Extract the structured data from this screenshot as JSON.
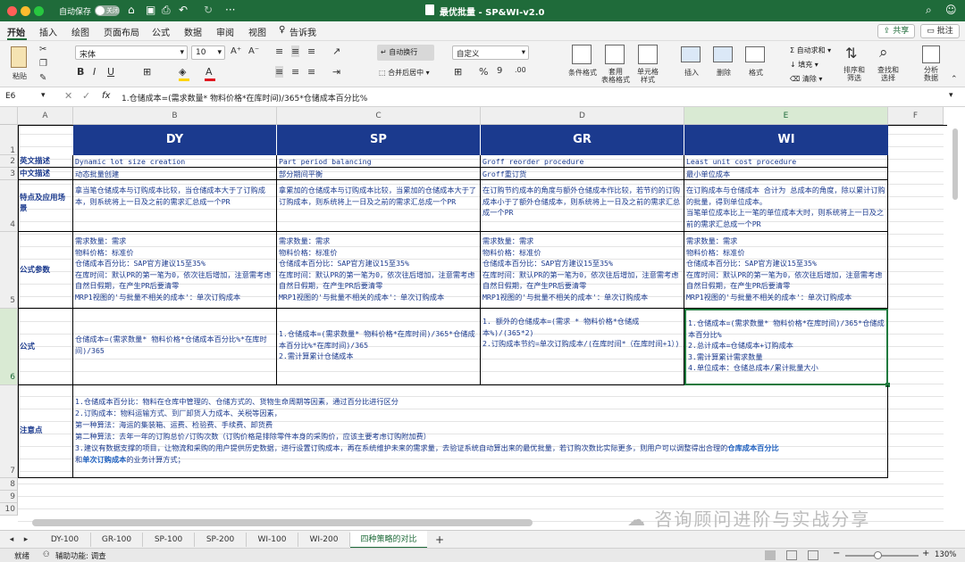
{
  "window": {
    "autosave_label": "自动保存",
    "autosave_state": "关闭",
    "title": "最优批量 - SP&WI-v2.0",
    "share": "共享",
    "comment": "批注"
  },
  "ribbon_tabs": [
    "开始",
    "插入",
    "绘图",
    "页面布局",
    "公式",
    "数据",
    "审阅",
    "视图"
  ],
  "tell_me": "告诉我",
  "ribbon": {
    "paste": "粘贴",
    "font_name": "宋体",
    "font_size": "10",
    "wrap_text": "自动换行",
    "merge_center": "合并后居中",
    "number_format": "自定义",
    "cond_format": "条件格式",
    "table_format": "套用\n表格格式",
    "cell_style": "单元格\n样式",
    "insert": "插入",
    "delete": "删除",
    "format": "格式",
    "autosum": "自动求和",
    "fill": "填充",
    "clear": "清除",
    "sort_filter": "排序和\n筛选",
    "find_select": "查找和\n选择",
    "analyze": "分析\n数据"
  },
  "formula_bar": {
    "name_box": "E6",
    "fx": "fx",
    "formula": "1.仓储成本=(需求数量* 物料价格*在库时间)/365*仓储成本百分比%"
  },
  "columns": [
    "A",
    "B",
    "C",
    "D",
    "E",
    "F"
  ],
  "rows": [
    "1",
    "2",
    "3",
    "4",
    "5",
    "6",
    "7",
    "8",
    "9",
    "10"
  ],
  "table": {
    "headers": [
      "DY",
      "SP",
      "GR",
      "WI"
    ],
    "row_labels": [
      "英文描述",
      "中文描述",
      "特点及应用场景",
      "公式参数",
      "公式",
      "注意点"
    ],
    "english": [
      "Dynamic lot size creation",
      "Part period balancing",
      "Groff reorder procedure",
      "Least unit cost procedure"
    ],
    "chinese": [
      "动态批量创建",
      "部分期间平衡",
      "Groff重订货",
      "最小单位成本"
    ],
    "features": [
      "拿当笔仓储成本与订购成本比较，当仓储成本大于了订购成本，则系统将上一日及之前的需求汇总成一个PR",
      "拿累加的仓储成本与订购成本比较，当累加的仓储成本大于了订购成本，则系统将上一日及之前的需求汇总成一个PR",
      "在订购节约成本的角度与额外仓储成本作比较，若节约的订购成本小于了额外仓储成本，则系统将上一日及之前的需求汇总成一个PR",
      "在订购成本与仓储成本 合计为 总成本的角度，除以累计订购的批量，得到单位成本。\n当笔单位成本比上一笔的单位成本大时，则系统将上一日及之前的需求汇总成一个PR"
    ],
    "params": "需求数量：需求\n物料价格：标准价\n仓储成本百分比：SAP官方建议15至35%\n在库时间：默认PR的第一笔为0，依次往后增加，注意需考虑自然日假期，在产生PR后要清零\nMRP1视图的'与批量不相关的成本'：单次订购成本",
    "formulas": [
      "仓储成本=(需求数量* 物料价格*仓储成本百分比%*在库时间)/365",
      "1.仓储成本=(需求数量* 物料价格*在库时间)/365*仓储成本百分比%*在库时间)/365\n2.需计算累计仓储成本",
      "1. 额外的仓储成本=(需求 * 物料价格*仓储成本%)/(365*2)\n2.订购成本节约=单次订购成本/(在库时间*（在库时间+1）)",
      "1.仓储成本=(需求数量* 物料价格*在库时间)/365*仓储成本百分比%\n2.总计成本=仓储成本+订购成本\n3.需计算累计需求数量\n4.单位成本：仓储总成本/累计批量大小"
    ],
    "notes_lines": [
      "1.仓储成本百分比：物料在仓库中管理的、仓储方式的、货物生命周期等因素，通过百分比进行区分",
      "2.订购成本：物料运输方式、到厂卸货人力成本、关税等因素，",
      "第一种算法：海运的集装箱、运费、检验费、手续费、卸货费",
      "第二种算法：去年一年的订购总价/订购次数（订购价格是排除零件本身的采购价，应该主要考虑订购附加费）",
      "3.建议有数据支撑的项目，让物流和采购的用户提供历史数据，进行设置订购成本，再在系统维护未来的需求量，去验证系统自动算出来的最优批量，若订购次数比实际更多，则用户可以调整得出合理的"
    ],
    "notes_bold1": "仓库成本百分比",
    "notes_mid": "和",
    "notes_bold2": "单次订购成本",
    "notes_end": "的业务计算方式；"
  },
  "watermark": "咨询顾问进阶与实战分享",
  "sheet_tabs": [
    "DY-100",
    "GR-100",
    "SP-100",
    "SP-200",
    "WI-100",
    "WI-200",
    "四种策略的对比"
  ],
  "status": {
    "ready": "就绪",
    "accessibility": "辅助功能: 调查",
    "zoom": "130%"
  }
}
